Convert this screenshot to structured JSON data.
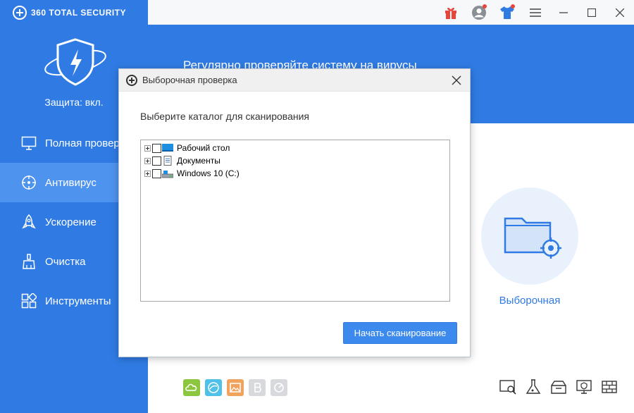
{
  "app": {
    "brand": "360 TOTAL SECURITY",
    "protection_status": "Защита: вкл."
  },
  "sidebar": {
    "items": [
      {
        "label": "Полная проверка",
        "icon": "monitor-icon",
        "active": false
      },
      {
        "label": "Антивирус",
        "icon": "crosshair-icon",
        "active": true
      },
      {
        "label": "Ускорение",
        "icon": "rocket-icon",
        "active": false
      },
      {
        "label": "Очистка",
        "icon": "broom-icon",
        "active": false
      },
      {
        "label": "Инструменты",
        "icon": "grid-icon",
        "active": false
      }
    ]
  },
  "titlebar": {
    "icons": [
      "gift-icon",
      "user-avatar-icon",
      "shirt-icon",
      "menu-icon",
      "minimize-icon",
      "maximize-icon",
      "close-icon"
    ]
  },
  "banner": {
    "text": "Регулярно проверяйте систему на вирусы"
  },
  "custom_scan": {
    "label": "Выборочная"
  },
  "dialog": {
    "title": "Выборочная проверка",
    "prompt": "Выберите каталог для сканирования",
    "tree": [
      {
        "label": "Рабочий стол",
        "icon": "desktop-folder-icon"
      },
      {
        "label": "Документы",
        "icon": "documents-icon"
      },
      {
        "label": "Windows 10 (C:)",
        "icon": "drive-icon"
      }
    ],
    "start_button": "Начать сканирование"
  },
  "colors": {
    "brand_blue": "#2f7be3",
    "active_nav": "#4e93ee",
    "button_blue": "#3d8aee"
  }
}
